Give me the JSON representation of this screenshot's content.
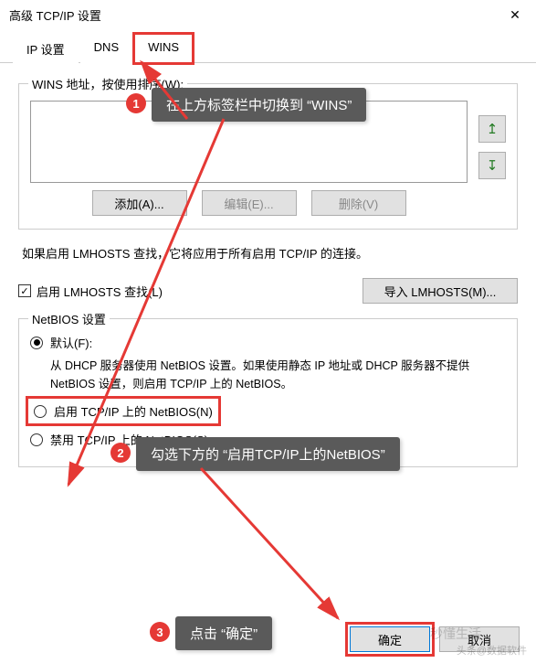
{
  "window": {
    "title": "高级 TCP/IP 设置",
    "close": "✕"
  },
  "tabs": {
    "ip": "IP 设置",
    "dns": "DNS",
    "wins": "WINS"
  },
  "wins_group": {
    "label": "WINS 地址，按使用排序(W):",
    "up": "↥",
    "down": "↧",
    "add": "添加(A)...",
    "edit": "编辑(E)...",
    "remove": "删除(V)"
  },
  "lmhosts": {
    "note": "如果启用 LMHOSTS 查找，它将应用于所有启用 TCP/IP 的连接。",
    "enable": "启用 LMHOSTS 查找(L)",
    "import": "导入 LMHOSTS(M)..."
  },
  "netbios": {
    "legend": "NetBIOS 设置",
    "default_label": "默认(F):",
    "default_desc": "从 DHCP 服务器使用 NetBIOS 设置。如果使用静态 IP 地址或 DHCP 服务器不提供 NetBIOS 设置，则启用 TCP/IP 上的 NetBIOS。",
    "enable_label": "启用 TCP/IP 上的 NetBIOS(N)",
    "disable_label": "禁用 TCP/IP 上的 NetBIOS(S)"
  },
  "footer": {
    "ok": "确定",
    "cancel": "取消"
  },
  "callouts": {
    "c1": "在上方标签栏中切换到 “WINS”",
    "c2": "勾选下方的 “启用TCP/IP上的NetBIOS”",
    "c3": "点击 “确定”",
    "n1": "1",
    "n2": "2",
    "n3": "3"
  },
  "watermark": "头条@数据软件",
  "watermark2": "秒懂生活"
}
